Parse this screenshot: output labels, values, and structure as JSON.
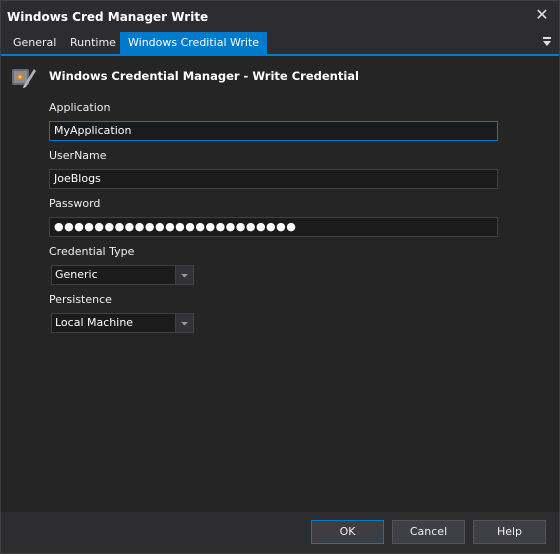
{
  "window": {
    "title": "Windows Cred Manager Write"
  },
  "tabs": [
    {
      "label": "General"
    },
    {
      "label": "Runtime"
    },
    {
      "label": "Windows Creditial Write"
    }
  ],
  "header": {
    "title": "Windows Credential Manager - Write Credential",
    "icon": "credential-pencil-icon"
  },
  "form": {
    "application": {
      "label": "Application",
      "value": "MyApplication"
    },
    "username": {
      "label": "UserName",
      "value": "JoeBlogs"
    },
    "password": {
      "label": "Password",
      "value": "●●●●●●●●●●●●●●●●●●●●●●●●"
    },
    "credential_type": {
      "label": "Credential Type",
      "value": "Generic"
    },
    "persistence": {
      "label": "Persistence",
      "value": "Local Machine"
    }
  },
  "buttons": {
    "ok": "OK",
    "cancel": "Cancel",
    "help": "Help"
  },
  "colors": {
    "accent": "#007acc",
    "background": "#252526",
    "input": "#1b1b1c"
  }
}
